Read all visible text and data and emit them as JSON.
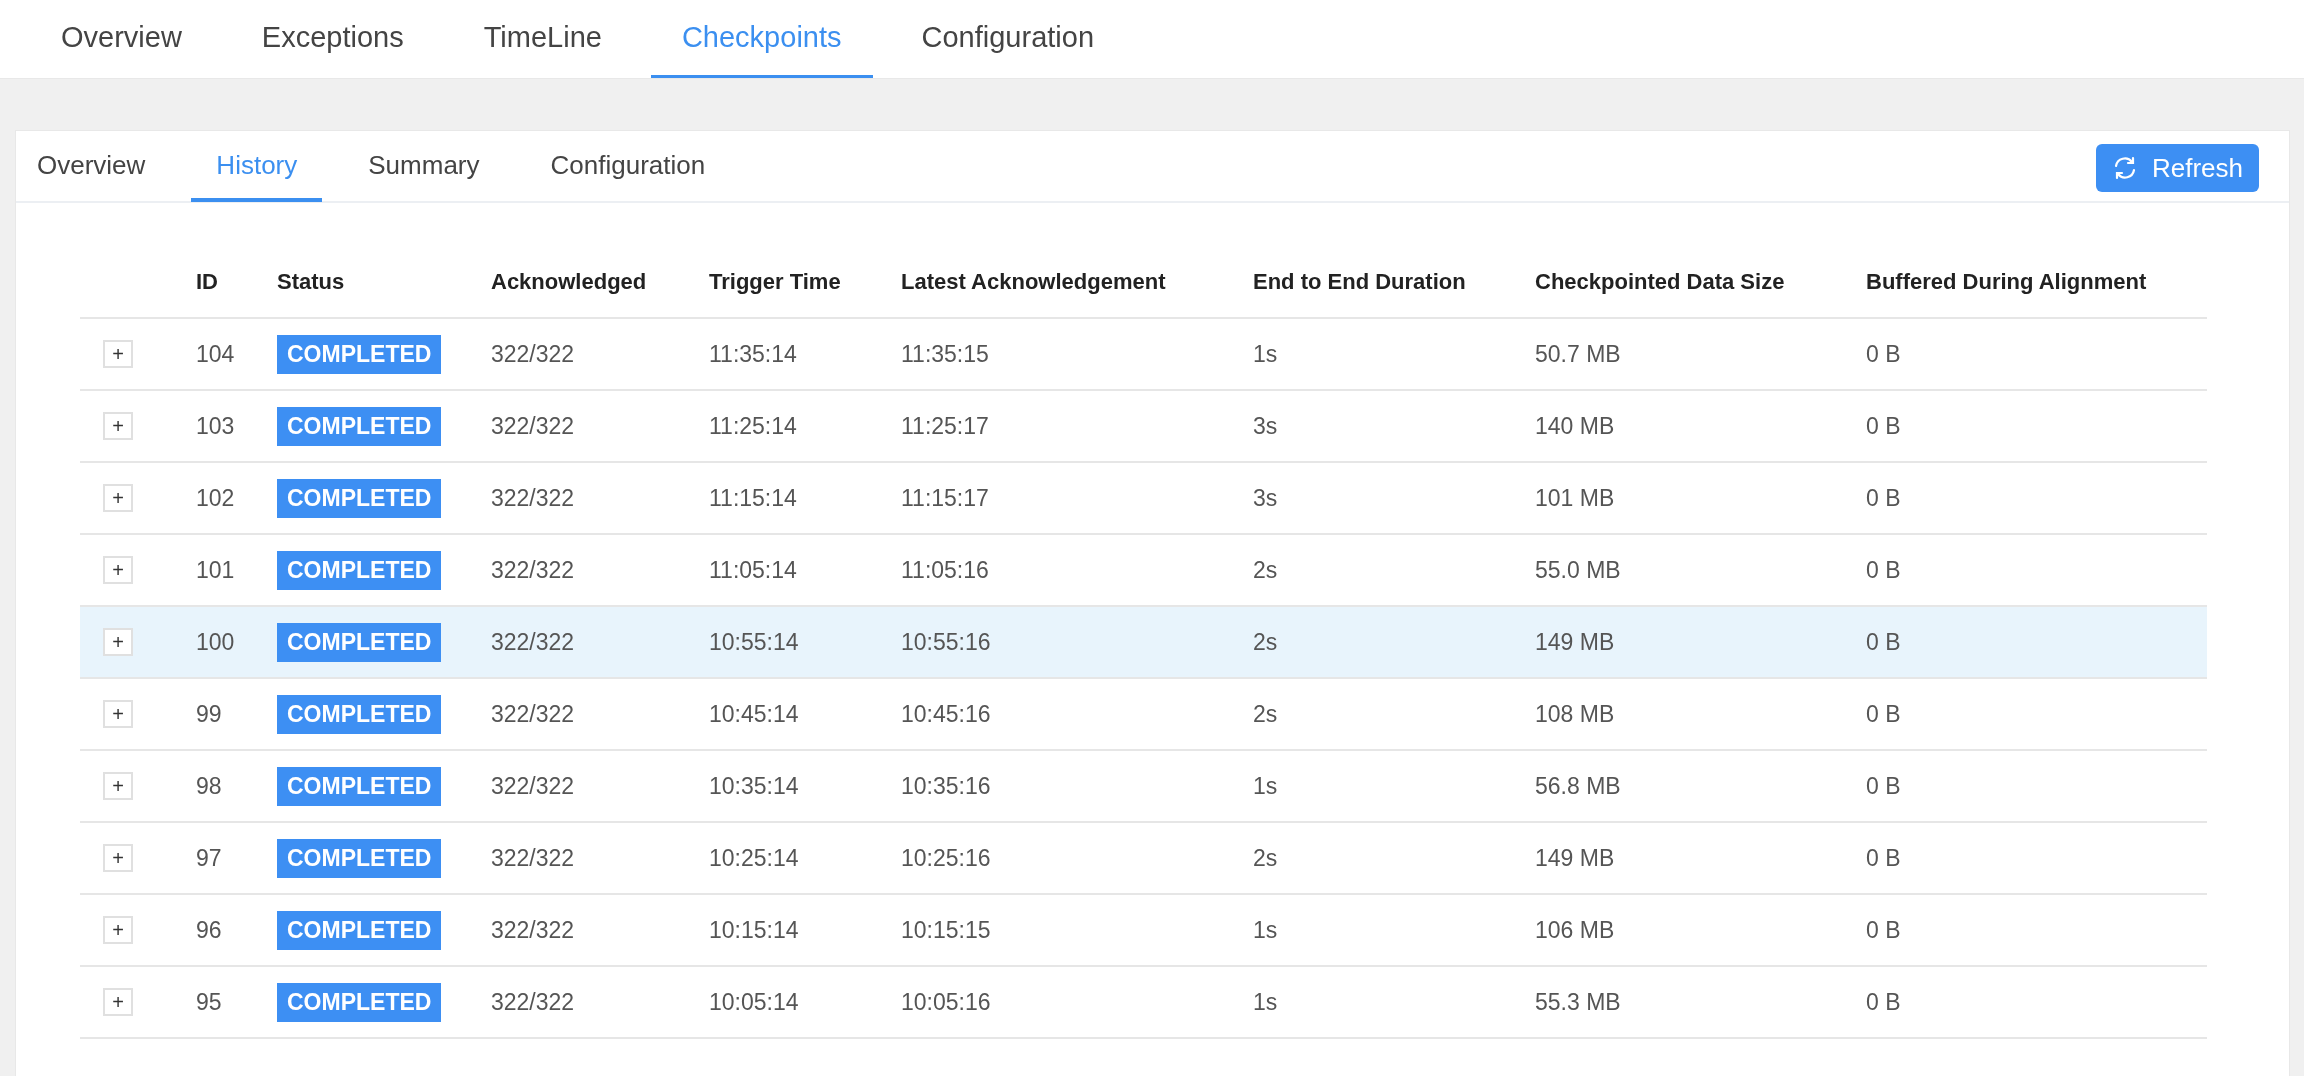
{
  "top_tabs": [
    {
      "label": "Overview",
      "selected": false
    },
    {
      "label": "Exceptions",
      "selected": false
    },
    {
      "label": "TimeLine",
      "selected": false
    },
    {
      "label": "Checkpoints",
      "selected": true
    },
    {
      "label": "Configuration",
      "selected": false
    }
  ],
  "sub_tabs": [
    {
      "label": "Overview",
      "selected": false
    },
    {
      "label": "History",
      "selected": true
    },
    {
      "label": "Summary",
      "selected": false
    },
    {
      "label": "Configuration",
      "selected": false
    }
  ],
  "refresh_button": {
    "label": "Refresh"
  },
  "table": {
    "columns": [
      "ID",
      "Status",
      "Acknowledged",
      "Trigger Time",
      "Latest Acknowledgement",
      "End to End Duration",
      "Checkpointed Data Size",
      "Buffered During Alignment"
    ],
    "rows": [
      {
        "expand": "+",
        "id": "104",
        "status": "COMPLETED",
        "acknowledged": "322/322",
        "trigger_time": "11:35:14",
        "latest_ack": "11:35:15",
        "duration": "1s",
        "data_size": "50.7 MB",
        "buffered": "0 B",
        "highlighted": false
      },
      {
        "expand": "+",
        "id": "103",
        "status": "COMPLETED",
        "acknowledged": "322/322",
        "trigger_time": "11:25:14",
        "latest_ack": "11:25:17",
        "duration": "3s",
        "data_size": "140 MB",
        "buffered": "0 B",
        "highlighted": false
      },
      {
        "expand": "+",
        "id": "102",
        "status": "COMPLETED",
        "acknowledged": "322/322",
        "trigger_time": "11:15:14",
        "latest_ack": "11:15:17",
        "duration": "3s",
        "data_size": "101 MB",
        "buffered": "0 B",
        "highlighted": false
      },
      {
        "expand": "+",
        "id": "101",
        "status": "COMPLETED",
        "acknowledged": "322/322",
        "trigger_time": "11:05:14",
        "latest_ack": "11:05:16",
        "duration": "2s",
        "data_size": "55.0 MB",
        "buffered": "0 B",
        "highlighted": false
      },
      {
        "expand": "+",
        "id": "100",
        "status": "COMPLETED",
        "acknowledged": "322/322",
        "trigger_time": "10:55:14",
        "latest_ack": "10:55:16",
        "duration": "2s",
        "data_size": "149 MB",
        "buffered": "0 B",
        "highlighted": true
      },
      {
        "expand": "+",
        "id": "99",
        "status": "COMPLETED",
        "acknowledged": "322/322",
        "trigger_time": "10:45:14",
        "latest_ack": "10:45:16",
        "duration": "2s",
        "data_size": "108 MB",
        "buffered": "0 B",
        "highlighted": false
      },
      {
        "expand": "+",
        "id": "98",
        "status": "COMPLETED",
        "acknowledged": "322/322",
        "trigger_time": "10:35:14",
        "latest_ack": "10:35:16",
        "duration": "1s",
        "data_size": "56.8 MB",
        "buffered": "0 B",
        "highlighted": false
      },
      {
        "expand": "+",
        "id": "97",
        "status": "COMPLETED",
        "acknowledged": "322/322",
        "trigger_time": "10:25:14",
        "latest_ack": "10:25:16",
        "duration": "2s",
        "data_size": "149 MB",
        "buffered": "0 B",
        "highlighted": false
      },
      {
        "expand": "+",
        "id": "96",
        "status": "COMPLETED",
        "acknowledged": "322/322",
        "trigger_time": "10:15:14",
        "latest_ack": "10:15:15",
        "duration": "1s",
        "data_size": "106 MB",
        "buffered": "0 B",
        "highlighted": false
      },
      {
        "expand": "+",
        "id": "95",
        "status": "COMPLETED",
        "acknowledged": "322/322",
        "trigger_time": "10:05:14",
        "latest_ack": "10:05:16",
        "duration": "1s",
        "data_size": "55.3 MB",
        "buffered": "0 B",
        "highlighted": false
      }
    ]
  }
}
